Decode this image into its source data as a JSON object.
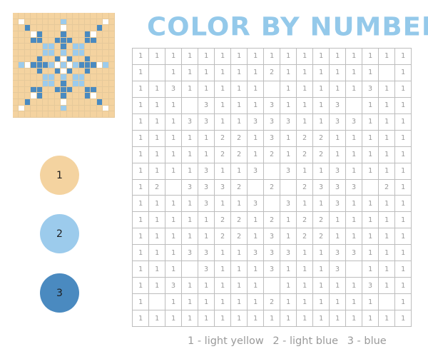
{
  "title": "COLOR BY NUMBERS",
  "colors": {
    "0": "#ffffff",
    "1": "#f4d3a0",
    "2": "#9ccbec",
    "3": "#4a8ac0"
  },
  "palette": [
    {
      "number": "1",
      "color": "#f4d3a0",
      "name": "light yellow"
    },
    {
      "number": "2",
      "color": "#9ccbec",
      "name": "light blue"
    },
    {
      "number": "3",
      "color": "#4a8ac0",
      "name": "blue"
    }
  ],
  "legend": [
    "1 - light yellow",
    "2 - light blue",
    "3 - blue"
  ],
  "grid": [
    [
      1,
      1,
      1,
      1,
      1,
      1,
      1,
      1,
      1,
      1,
      1,
      1,
      1,
      1,
      1,
      1,
      1
    ],
    [
      1,
      0,
      1,
      1,
      1,
      1,
      1,
      1,
      2,
      1,
      1,
      1,
      1,
      1,
      1,
      0,
      1
    ],
    [
      1,
      1,
      3,
      1,
      1,
      1,
      1,
      1,
      0,
      1,
      1,
      1,
      1,
      1,
      3,
      1,
      1
    ],
    [
      1,
      1,
      1,
      0,
      3,
      1,
      1,
      1,
      3,
      1,
      1,
      1,
      3,
      0,
      1,
      1,
      1
    ],
    [
      1,
      1,
      1,
      3,
      3,
      1,
      1,
      3,
      3,
      3,
      1,
      1,
      3,
      3,
      1,
      1,
      1
    ],
    [
      1,
      1,
      1,
      1,
      1,
      2,
      2,
      1,
      3,
      1,
      2,
      2,
      1,
      1,
      1,
      1,
      1
    ],
    [
      1,
      1,
      1,
      1,
      1,
      2,
      2,
      1,
      2,
      1,
      2,
      2,
      1,
      1,
      1,
      1,
      1
    ],
    [
      1,
      1,
      1,
      1,
      3,
      1,
      1,
      3,
      0,
      3,
      1,
      1,
      3,
      1,
      1,
      1,
      1
    ],
    [
      1,
      2,
      0,
      3,
      3,
      3,
      2,
      0,
      2,
      0,
      2,
      3,
      3,
      3,
      0,
      2,
      1
    ],
    [
      1,
      1,
      1,
      1,
      3,
      1,
      1,
      3,
      0,
      3,
      1,
      1,
      3,
      1,
      1,
      1,
      1
    ],
    [
      1,
      1,
      1,
      1,
      1,
      2,
      2,
      1,
      2,
      1,
      2,
      2,
      1,
      1,
      1,
      1,
      1
    ],
    [
      1,
      1,
      1,
      1,
      1,
      2,
      2,
      1,
      3,
      1,
      2,
      2,
      1,
      1,
      1,
      1,
      1
    ],
    [
      1,
      1,
      1,
      3,
      3,
      1,
      1,
      3,
      3,
      3,
      1,
      1,
      3,
      3,
      1,
      1,
      1
    ],
    [
      1,
      1,
      1,
      0,
      3,
      1,
      1,
      1,
      3,
      1,
      1,
      1,
      3,
      0,
      1,
      1,
      1
    ],
    [
      1,
      1,
      3,
      1,
      1,
      1,
      1,
      1,
      0,
      1,
      1,
      1,
      1,
      1,
      3,
      1,
      1
    ],
    [
      1,
      0,
      1,
      1,
      1,
      1,
      1,
      1,
      2,
      1,
      1,
      1,
      1,
      1,
      1,
      0,
      1
    ],
    [
      1,
      1,
      1,
      1,
      1,
      1,
      1,
      1,
      1,
      1,
      1,
      1,
      1,
      1,
      1,
      1,
      1
    ]
  ]
}
